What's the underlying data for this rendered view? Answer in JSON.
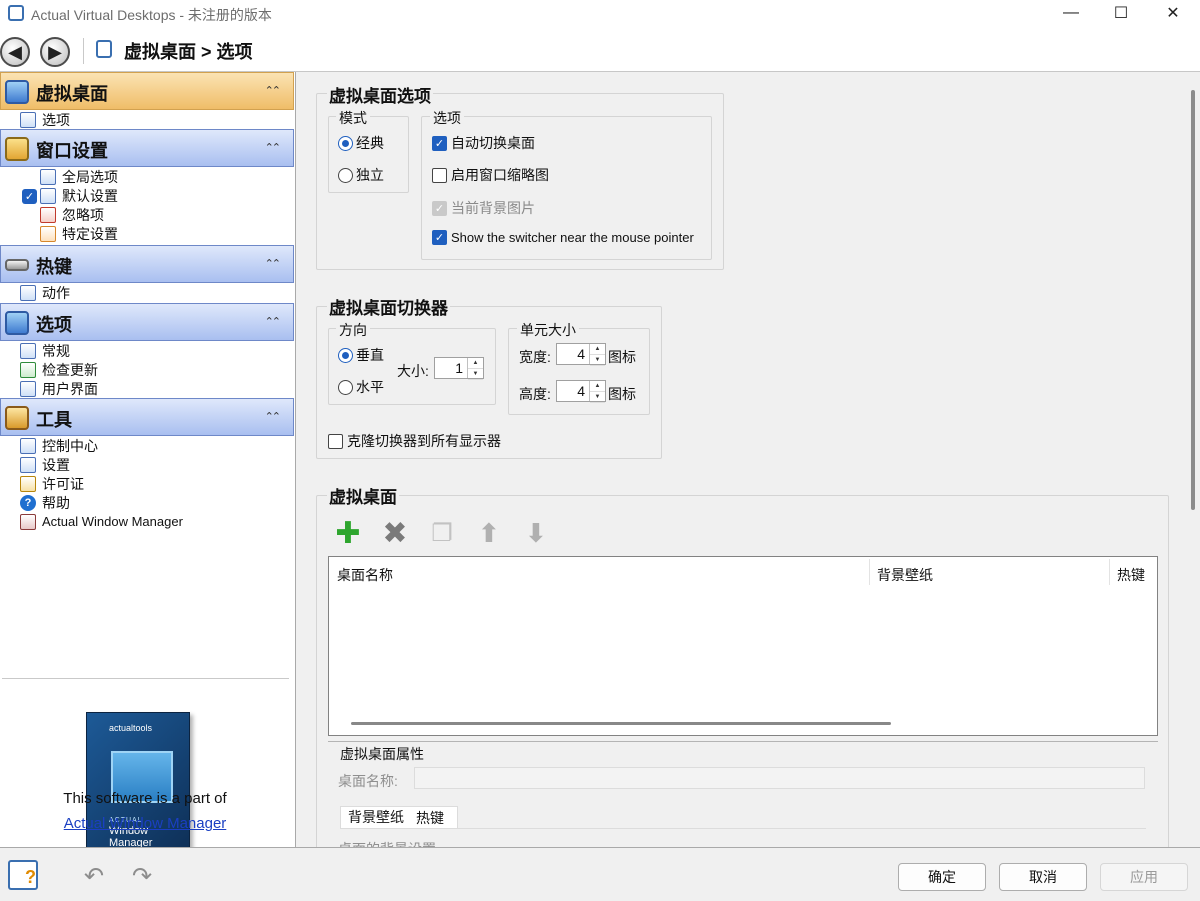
{
  "window": {
    "title": "Actual Virtual Desktops - 未注册的版本",
    "minimize_glyph": "—",
    "maximize_glyph": "☐",
    "close_glyph": "✕"
  },
  "toolbar": {
    "breadcrumb": "虚拟桌面 > 选项"
  },
  "sidebar": {
    "sections": [
      {
        "title": "虚拟桌面",
        "items": [
          "选项"
        ]
      },
      {
        "title": "窗口设置",
        "items": [
          "全局选项",
          "默认设置",
          "忽略项",
          "特定设置"
        ]
      },
      {
        "title": "热键",
        "items": [
          "动作"
        ]
      },
      {
        "title": "选项",
        "items": [
          "常规",
          "检查更新",
          "用户界面"
        ]
      },
      {
        "title": "工具",
        "items": [
          "控制中心",
          "设置",
          "许可证",
          "帮助",
          "Actual Window Manager"
        ]
      }
    ],
    "collapse_glyph": "⌃⌃",
    "checked_item": "默认设置"
  },
  "promo": {
    "box_logo": "actualtools",
    "box_caption": "ACTUAL",
    "box_product": "Window Manager",
    "text": "This software is a part of",
    "link": "Actual Window Manager"
  },
  "options": {
    "title": "虚拟桌面选项",
    "mode_title": "模式",
    "mode_options": [
      "经典",
      "独立"
    ],
    "mode_selected": "经典",
    "opts_title": "选项",
    "checkboxes": [
      {
        "label": "自动切换桌面",
        "checked": true,
        "disabled": false
      },
      {
        "label": "启用窗口缩略图",
        "checked": false,
        "disabled": false
      },
      {
        "label": "当前背景图片",
        "checked": true,
        "disabled": true
      },
      {
        "label": "Show the switcher near the mouse pointer",
        "checked": true,
        "disabled": false
      }
    ]
  },
  "switcher": {
    "title": "虚拟桌面切换器",
    "direction_title": "方向",
    "direction_options": [
      "垂直",
      "水平"
    ],
    "direction_selected": "垂直",
    "size_label": "大小:",
    "size_value": "1",
    "cell_title": "单元大小",
    "width_label": "宽度:",
    "width_value": "4",
    "height_label": "高度:",
    "height_value": "4",
    "unit": "图标",
    "clone_label": "克隆切换器到所有显示器",
    "clone_checked": false
  },
  "desktops": {
    "title": "虚拟桌面",
    "columns": [
      "桌面名称",
      "背景壁纸",
      "热键"
    ],
    "rows": [],
    "props_title": "虚拟桌面属性",
    "name_label": "桌面名称:",
    "tabs": [
      "背景壁纸",
      "热键"
    ],
    "partial_text": "桌面的背景设置"
  },
  "buttons": {
    "ok": "确定",
    "cancel": "取消",
    "apply": "应用"
  },
  "colors": {
    "accent": "#1f5fbf",
    "active_section": "#efbd68",
    "section": "#a9bff0",
    "link": "#1a3fc2"
  }
}
